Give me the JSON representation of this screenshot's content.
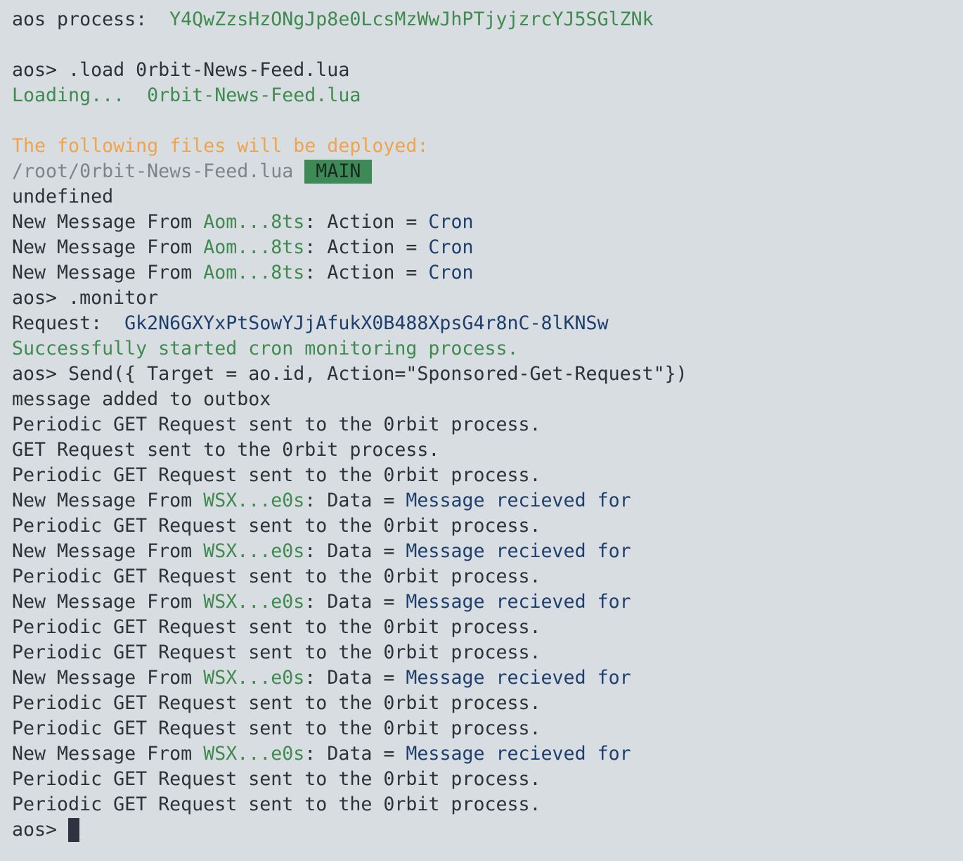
{
  "colors": {
    "background": "#d8dde1",
    "text": "#2e3137",
    "green": "#3f8a4f",
    "orange": "#efa44c",
    "gray": "#7d838b",
    "blue": "#1e3f6e",
    "badge_bg": "#3d8a56",
    "cursor": "#2f3340"
  },
  "header": {
    "process_label": "aos process:  ",
    "process_id": "Y4QwZzsHzONgJp8e0LcsMzWwJhPTjyjzrcYJ5SGlZNk"
  },
  "prompt": "aos> ",
  "commands": {
    "load": ".load 0rbit-News-Feed.lua",
    "monitor": ".monitor",
    "send": "Send({ Target = ao.id, Action=\"Sponsored-Get-Request\"})"
  },
  "loading": {
    "label": "Loading...  ",
    "file": "0rbit-News-Feed.lua"
  },
  "deploy": {
    "heading": "The following files will be deployed:",
    "path": "/root/0rbit-News-Feed.lua",
    "badge": "MAIN"
  },
  "undefined_text": "undefined",
  "msg": {
    "prefix": "New Message From ",
    "cron_sender": "Aom...8ts",
    "cron_mid": ": Action = ",
    "cron_value": "Cron",
    "wsx_sender": "WSX...e0s",
    "wsx_mid": ": Data = ",
    "wsx_value": "Message recieved for"
  },
  "request": {
    "label": "Request:  ",
    "id": "Gk2N6GXYxPtSowYJjAfukX0B488XpsG4r8nC-8lKNSw"
  },
  "monitor_success": "Successfully started cron monitoring process.",
  "outbox": "message added to outbox",
  "periodic": "Periodic GET Request sent to the 0rbit process.",
  "get_request": "GET Request sent to the 0rbit process."
}
